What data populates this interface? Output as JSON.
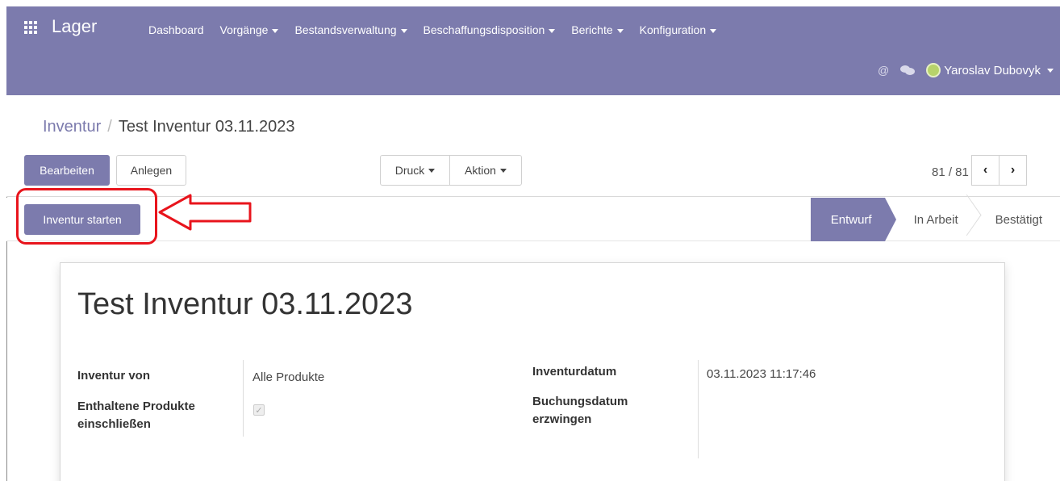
{
  "navbar": {
    "app_title": "Lager",
    "menu": [
      {
        "label": "Dashboard",
        "dropdown": false
      },
      {
        "label": "Vorgänge",
        "dropdown": true
      },
      {
        "label": "Bestandsverwaltung",
        "dropdown": true
      },
      {
        "label": "Beschaffungsdisposition",
        "dropdown": true
      },
      {
        "label": "Berichte",
        "dropdown": true
      },
      {
        "label": "Konfiguration",
        "dropdown": true
      }
    ],
    "user_name": "Yaroslav Dubovyk",
    "mention_symbol": "@"
  },
  "breadcrumb": {
    "parent": "Inventur",
    "separator": "/",
    "current": "Test Inventur 03.11.2023"
  },
  "buttons": {
    "edit": "Bearbeiten",
    "create": "Anlegen",
    "print": "Druck",
    "action": "Aktion",
    "start_inventory": "Inventur starten"
  },
  "pager": {
    "value": "81 / 81",
    "prev": "‹",
    "next": "›"
  },
  "statusbar": {
    "steps": [
      "Entwurf",
      "In Arbeit",
      "Bestätigt"
    ],
    "active_step": "Entwurf"
  },
  "form": {
    "title": "Test Inventur 03.11.2023",
    "inventory_of_label": "Inventur von",
    "inventory_of_value": "Alle Produkte",
    "include_products_label_line1": "Enthaltene Produkte",
    "include_products_label_line2": "einschließen",
    "include_products_checked": true,
    "inventory_date_label": "Inventurdatum",
    "inventory_date_value": "03.11.2023 11:17:46",
    "force_date_label_line1": "Buchungsdatum",
    "force_date_label_line2": "erzwingen"
  },
  "colors": {
    "brand": "#7c7bad",
    "annotation_red": "#e8141c"
  },
  "icons": {
    "apps": "apps-grid-icon",
    "mention": "at-icon",
    "chat": "chat-icon",
    "avatar": "avatar"
  }
}
